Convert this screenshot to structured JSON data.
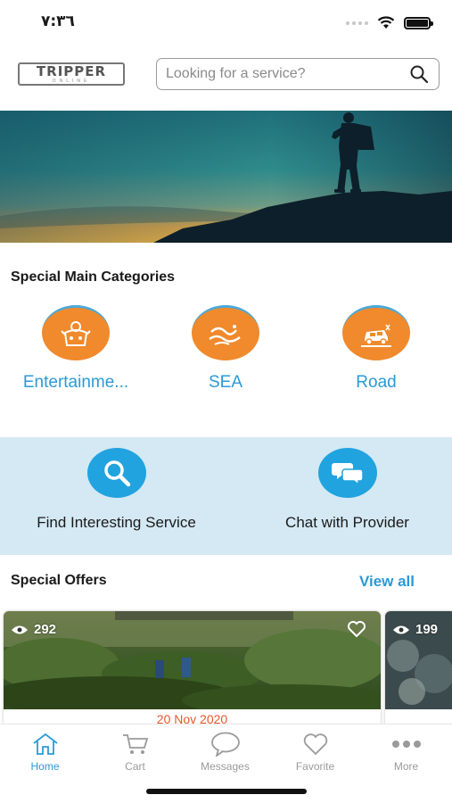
{
  "status_bar": {
    "time": "٧:٣٦"
  },
  "header": {
    "logo_text": "TRIPPER",
    "logo_subtext": "ONLINE",
    "search_placeholder": "Looking for a service?"
  },
  "categories_section": {
    "title": "Special Main Categories",
    "items": [
      {
        "label": "Entertainme...",
        "icon": "entertainment-icon"
      },
      {
        "label": "SEA",
        "icon": "sea-wave-icon"
      },
      {
        "label": "Road",
        "icon": "road-car-icon"
      }
    ]
  },
  "quick_actions": [
    {
      "label": "Find Interesting Service",
      "icon": "search-icon"
    },
    {
      "label": "Chat with Provider",
      "icon": "chat-bubbles-icon"
    }
  ],
  "offers_section": {
    "title": "Special Offers",
    "view_all": "View all",
    "cards": [
      {
        "views": "292",
        "date": "20 Nov 2020"
      },
      {
        "views": "199"
      }
    ]
  },
  "tab_bar": {
    "tabs": [
      {
        "label": "Home",
        "icon": "home-icon",
        "active": true
      },
      {
        "label": "Cart",
        "icon": "cart-icon",
        "active": false
      },
      {
        "label": "Messages",
        "icon": "message-bubble-icon",
        "active": false
      },
      {
        "label": "Favorite",
        "icon": "heart-icon",
        "active": false
      },
      {
        "label": "More",
        "icon": "more-dots-icon",
        "active": false
      }
    ]
  },
  "colors": {
    "accent_blue": "#2b9ad6",
    "category_orange": "#f08a2c",
    "quick_action_bg": "#d4e9f4",
    "quick_action_circle": "#21a3df",
    "date_red": "#e9562b"
  }
}
